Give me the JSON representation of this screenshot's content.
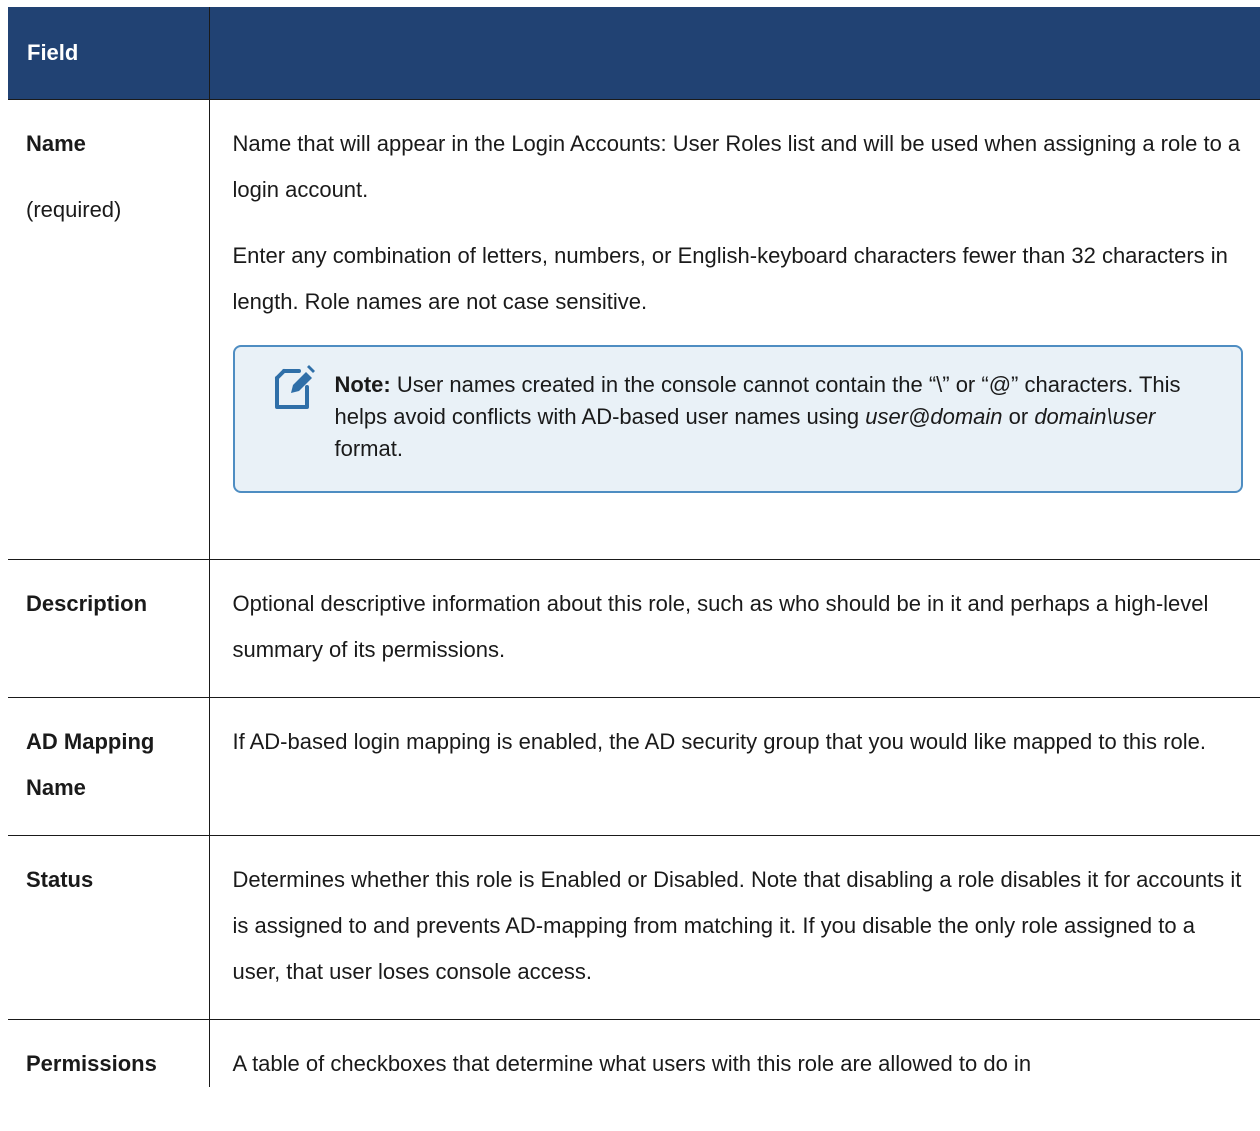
{
  "table": {
    "header": {
      "field": "Field",
      "description": ""
    },
    "rows": [
      {
        "field": "Name",
        "field_sub": "(required)",
        "paragraphs": [
          "Name that will appear in the Login Accounts: User Roles list and will be used when assigning a role to a login account.",
          "Enter any combination of letters, numbers, or English-keyboard characters fewer than 32 characters in length. Role names are not case sensitive."
        ],
        "note": {
          "icon": "note-icon",
          "label": "Note:",
          "text_1": " User names created in the console cannot contain the “\\” or “@” characters. This helps avoid conflicts with AD-based user names using ",
          "italic_1": "user@domain",
          "text_2": " or ",
          "italic_2": "domain\\user",
          "text_3": " format."
        }
      },
      {
        "field": "Description",
        "paragraphs": [
          "Optional descriptive information about this role, such as who should be in it and perhaps a high-level summary of its permissions."
        ]
      },
      {
        "field": "AD Mapping Name",
        "paragraphs": [
          "If AD-based login mapping is enabled, the AD security group that you would like mapped to this role."
        ]
      },
      {
        "field": "Status",
        "paragraphs": [
          "Determines whether this role is Enabled or Disabled. Note that disabling a role disables it for accounts it is assigned to and prevents AD-mapping from matching it. If you disable the only role assigned to a user, that user loses console access."
        ]
      },
      {
        "field": "Permissions",
        "paragraphs": [
          "A table of checkboxes that determine what users with this role are allowed to do in"
        ]
      }
    ]
  },
  "colors": {
    "header_bg": "#214273",
    "note_bg": "#e9f1f7",
    "note_border": "#4e8dc2"
  }
}
